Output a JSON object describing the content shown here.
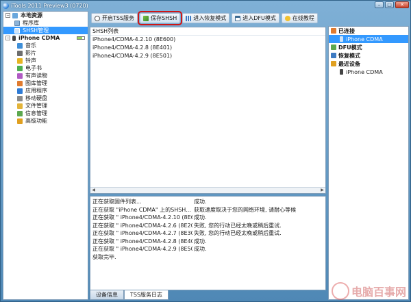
{
  "window": {
    "title": "iTools 2011 Preview3 (0720)"
  },
  "colors": {
    "accent": "#3399ff",
    "highlight": "#d01515",
    "titlebar": "#4f88b5"
  },
  "sidebar": {
    "local_group": "本地资源",
    "local_items": [
      {
        "label": "程序库",
        "icon": "library-icon"
      },
      {
        "label": "SHSH管理",
        "icon": "shsh-icon",
        "selected": true
      }
    ],
    "device_group": "iPhone CDMA",
    "device_items": [
      {
        "label": "音乐",
        "icon": "music-icon",
        "color": "#3f8fd8"
      },
      {
        "label": "影片",
        "icon": "movie-icon",
        "color": "#6d6d6d"
      },
      {
        "label": "铃声",
        "icon": "bell-icon",
        "color": "#e6b422"
      },
      {
        "label": "电子书",
        "icon": "ebook-icon",
        "color": "#4caf50"
      },
      {
        "label": "有声读物",
        "icon": "audiobook-icon",
        "color": "#b05bc4"
      },
      {
        "label": "图库管理",
        "icon": "photo-icon",
        "color": "#e07b2f"
      },
      {
        "label": "应用程序",
        "icon": "apps-icon",
        "color": "#2e7bd6"
      },
      {
        "label": "移动硬盘",
        "icon": "disk-icon",
        "color": "#8a8a8a"
      },
      {
        "label": "文件管理",
        "icon": "folder-icon",
        "color": "#e3b43a"
      },
      {
        "label": "信息管理",
        "icon": "message-icon",
        "color": "#5ca84f"
      },
      {
        "label": "高级功能",
        "icon": "star-icon",
        "color": "#e0a020"
      }
    ]
  },
  "toolbar": {
    "buttons": [
      {
        "label": "开启TSS服务",
        "icon": "play-icon"
      },
      {
        "label": "保存SHSH",
        "icon": "save-icon",
        "highlighted": true
      },
      {
        "label": "进入恢复模式",
        "icon": "grid-icon"
      },
      {
        "label": "进入DFU模式",
        "icon": "window-icon"
      },
      {
        "label": "在线教程",
        "icon": "tutorial-icon"
      }
    ]
  },
  "shsh_list": {
    "header": "SHSH列表",
    "items": [
      "iPhone4/CDMA-4.2.10 (8E600)",
      "iPhone4/CDMA-4.2.8 (8E401)",
      "iPhone4/CDMA-4.2.9 (8E501)"
    ]
  },
  "log": {
    "rows": [
      {
        "msg": "正在获取固件列表...",
        "result": "成功."
      },
      {
        "msg": "正在获取 \"iPhone CDMA\" 上的SHSH...",
        "result": "获取速度取决于您的网络环境, 请耐心等候"
      },
      {
        "msg": "正在获取 \" iPhone4/CDMA-4.2.10 (8E600...",
        "result": "成功."
      },
      {
        "msg": "正在获取 \" iPhone4/CDMA-4.2.6 (8E200) ...",
        "result": "失败, 您的行动已经太晚或稍后重试."
      },
      {
        "msg": "正在获取 \" iPhone4/CDMA-4.2.7 (8E303) ...",
        "result": "失败, 您的行动已经太晚或稍后重试."
      },
      {
        "msg": "正在获取 \" iPhone4/CDMA-4.2.8 (8E401) ...",
        "result": "成功."
      },
      {
        "msg": "正在获取 \" iPhone4/CDMA-4.2.9 (8E501) ...",
        "result": "成功."
      },
      {
        "msg": "获取完毕.",
        "result": ""
      }
    ]
  },
  "tabs": [
    {
      "label": "设备信息",
      "active": false
    },
    {
      "label": "TSS服务日志",
      "active": true
    }
  ],
  "right_panel": {
    "connected_label": "已连接",
    "connected_device": "iPhone CDMA",
    "dfu_label": "DFU模式",
    "recovery_label": "恢复模式",
    "recent_label": "最近设备",
    "recent_device": "iPhone CDMA"
  },
  "watermark": {
    "text": "电脑百事网"
  }
}
